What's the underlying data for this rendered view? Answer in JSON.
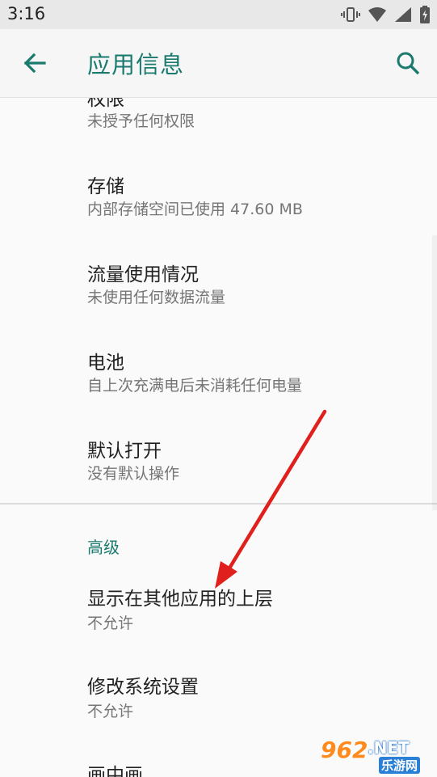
{
  "status_bar": {
    "time": "3:16",
    "icons": [
      "vibrate-icon",
      "wifi-icon",
      "signal-icon",
      "battery-charging-icon"
    ]
  },
  "app_bar": {
    "title": "应用信息",
    "back_icon": "arrow-back-icon",
    "search_icon": "search-icon",
    "accent_color": "#1a7a6e"
  },
  "list": {
    "partial_item": {
      "title": "权限",
      "subtitle": "未授予任何权限"
    },
    "items": [
      {
        "title": "存储",
        "subtitle": "内部存储空间已使用 47.60 MB"
      },
      {
        "title": "流量使用情况",
        "subtitle": "未使用任何数据流量"
      },
      {
        "title": "电池",
        "subtitle": "自上次充满电后未消耗任何电量"
      },
      {
        "title": "默认打开",
        "subtitle": "没有默认操作"
      }
    ],
    "section_header": "高级",
    "advanced_items": [
      {
        "title": "显示在其他应用的上层",
        "subtitle": "不允许"
      },
      {
        "title": "修改系统设置",
        "subtitle": "不允许"
      },
      {
        "title": "画中画"
      }
    ]
  },
  "annotation": {
    "type": "arrow",
    "color": "#e0201c"
  },
  "watermark": {
    "number": "962",
    "suffix": ".NET",
    "site": "乐游网"
  }
}
